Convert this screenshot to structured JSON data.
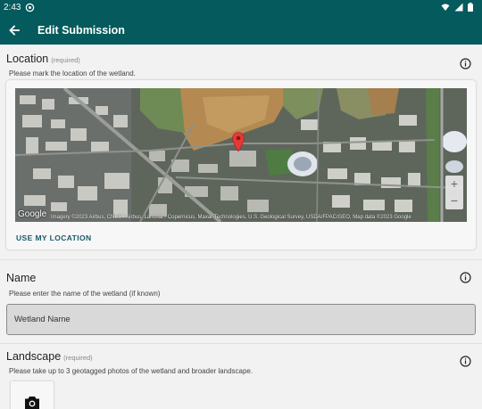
{
  "status_bar": {
    "time": "2:43",
    "icons": [
      "sync-icon",
      "wifi-icon",
      "signal-icon",
      "battery-icon"
    ]
  },
  "app_bar": {
    "title": "Edit Submission",
    "back_icon": "arrow-back-icon"
  },
  "location": {
    "title": "Location",
    "required": "(required)",
    "hint": "Please mark the location of the wetland.",
    "use_location_label": "USE MY LOCATION",
    "map": {
      "logo_text": "Google",
      "attribution": "Imagery ©2023 Airbus, CNES / Airbus, Landsat / Copernicus, Maxar Technologies, U.S. Geological Survey, USDA/FPAC/GEO, Map data ©2023 Google",
      "zoom_in": "+",
      "zoom_out": "−",
      "marker_icon": "map-pin-icon",
      "marker_color": "#e53935"
    },
    "info_icon": "info-icon"
  },
  "name": {
    "title": "Name",
    "hint": "Please enter the name of the wetland (if known)",
    "placeholder": "Wetland Name",
    "info_icon": "info-icon"
  },
  "landscape": {
    "title": "Landscape",
    "required": "(required)",
    "hint": "Please take up to 3 geotagged photos of the wetland and broader landscape.",
    "camera_icon": "camera-icon",
    "info_icon": "info-icon"
  },
  "colors": {
    "primary": "#045a5c",
    "accent_text": "#1b5b66",
    "background": "#f2f2f2"
  }
}
